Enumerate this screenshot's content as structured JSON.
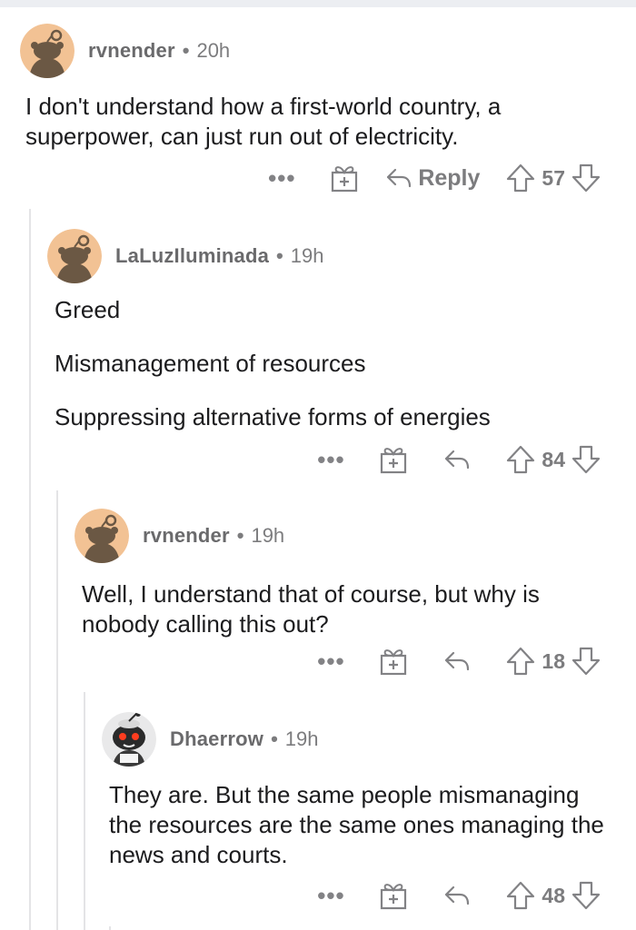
{
  "comments": [
    {
      "user": "rvnender",
      "time": "20h",
      "dot": "•",
      "text": [
        "I don't understand how a first-world country, a superpower, can just run out of electricity."
      ],
      "more": "•••",
      "reply_label": "Reply",
      "score": "57"
    },
    {
      "user": "LaLuzIluminada",
      "time": "19h",
      "dot": "•",
      "text": [
        "Greed",
        "Mismanagement of resources",
        "Suppressing alternative forms of energies"
      ],
      "more": "•••",
      "score": "84"
    },
    {
      "user": "rvnender",
      "time": "19h",
      "dot": "•",
      "text": [
        "Well, I understand that of course, but why is nobody calling this out?"
      ],
      "more": "•••",
      "score": "18"
    },
    {
      "user": "Dhaerrow",
      "time": "19h",
      "dot": "•",
      "text": [
        "They are. But the same people mismanaging the resources are the same ones managing the news and courts."
      ],
      "more": "•••",
      "score": "48"
    }
  ],
  "icons": {
    "avatar_default": "snoo-avatar-icon",
    "avatar_custom": "custom-snoo-avatar-icon",
    "more": "more-options-icon",
    "gift": "award-gift-icon",
    "reply": "reply-arrow-icon",
    "upvote": "upvote-arrow-icon",
    "downvote": "downvote-arrow-icon"
  },
  "colors": {
    "avatar_bg": "#f2c294",
    "snoo_body": "#6b5844",
    "text": "#1c1c1e",
    "meta": "#7c7c7e",
    "icon": "#828285",
    "thread_line": "#e4e4e6"
  }
}
